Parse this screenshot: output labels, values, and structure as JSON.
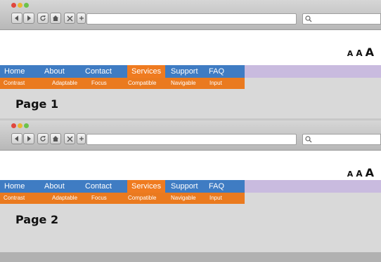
{
  "text_size": {
    "small": "A",
    "medium": "A",
    "large": "A"
  },
  "menu": [
    "Home",
    "About",
    "Contact",
    "Services",
    "Support",
    "FAQ"
  ],
  "submenu": [
    "Contrast",
    "Adaptable",
    "Focus",
    "Compatible",
    "Navigable",
    "Input"
  ],
  "panels": [
    {
      "label": "Page 1"
    },
    {
      "label": "Page 2"
    }
  ],
  "icons": [
    "back-icon",
    "forward-icon",
    "reload-icon",
    "home-icon",
    "close-icon",
    "new-tab-icon",
    "search-icon"
  ],
  "colors": {
    "menu_bg": "#3f7cc3",
    "active_tab": "#ef7b20",
    "submenu_bg": "#ea7a1f",
    "menu_trailing": "#c9bbdf"
  }
}
